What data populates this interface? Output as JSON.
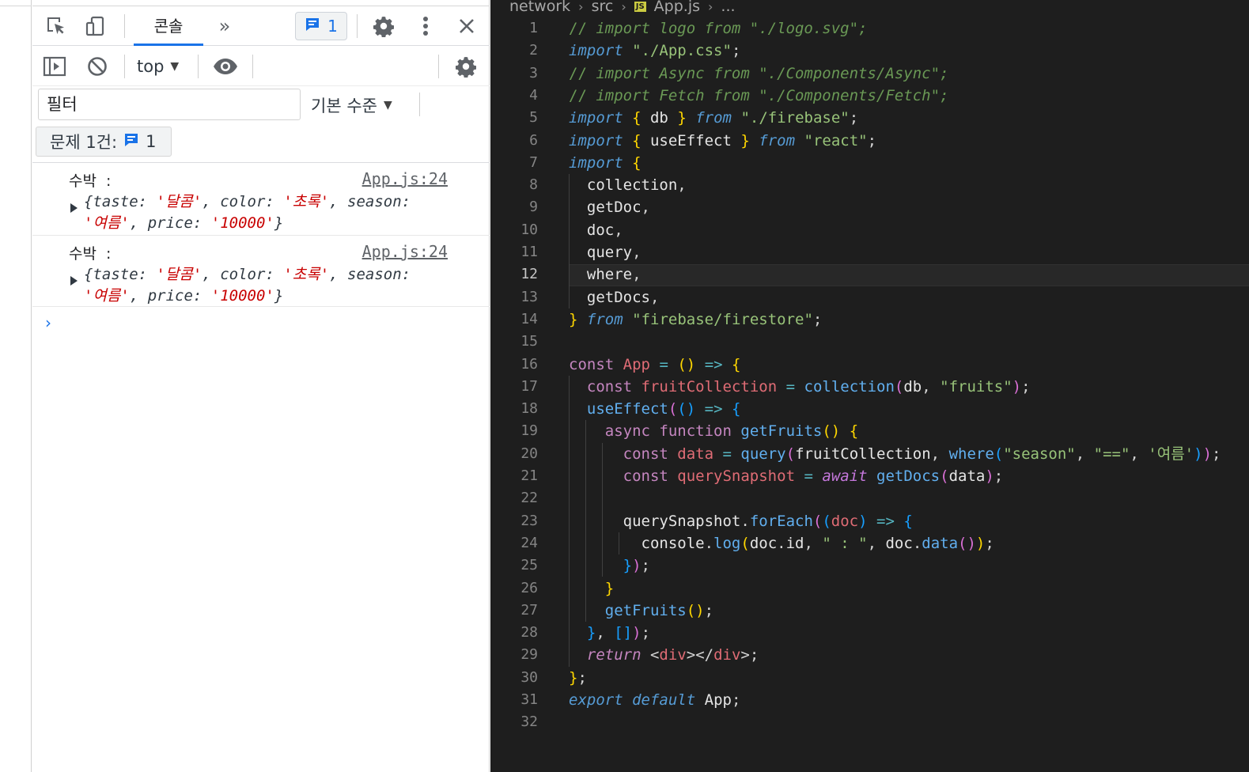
{
  "devtools": {
    "tabs": {
      "console_label": "콘솔",
      "more_label": "»",
      "issues_badge_count": "1"
    },
    "console_toolbar": {
      "context": "top",
      "level": "기본 수준",
      "filter_placeholder": "필터"
    },
    "issues_counter": {
      "label": "문제 1건:",
      "count": "1"
    },
    "messages": [
      {
        "label": "수박  :",
        "source": "App.js:24",
        "line1_prefix": "{taste: ",
        "taste": "'달콤'",
        "line1_mid": ", color: ",
        "color": "'초록'",
        "line1_suffix": ", season:",
        "season": "'여름'",
        "line2_mid": ", price: ",
        "price": "'10000'",
        "line2_suffix": "}"
      },
      {
        "label": "수박  :",
        "source": "App.js:24",
        "line1_prefix": "{taste: ",
        "taste": "'달콤'",
        "line1_mid": ", color: ",
        "color": "'초록'",
        "line1_suffix": ", season:",
        "season": "'여름'",
        "line2_mid": ", price: ",
        "price": "'10000'",
        "line2_suffix": "}"
      }
    ],
    "prompt": "›"
  },
  "editor": {
    "breadcrumb": [
      "network",
      "src",
      "App.js",
      "..."
    ],
    "file_badge": "JS",
    "active_line": 12,
    "line_numbers": [
      "1",
      "2",
      "3",
      "4",
      "5",
      "6",
      "7",
      "8",
      "9",
      "10",
      "11",
      "12",
      "13",
      "14",
      "15",
      "16",
      "17",
      "18",
      "19",
      "20",
      "21",
      "22",
      "23",
      "24",
      "25",
      "26",
      "27",
      "28",
      "29",
      "30",
      "31",
      "32"
    ],
    "code_tokens": [
      [
        [
          "cm-slash",
          "// "
        ],
        [
          "cm",
          "import logo from \"./logo.svg\";"
        ]
      ],
      [
        [
          "kw-i",
          "import"
        ],
        [
          "pl",
          " "
        ],
        [
          "s2",
          "\"./App.css\""
        ],
        [
          "pl",
          ";"
        ]
      ],
      [
        [
          "cm-slash",
          "// "
        ],
        [
          "cm",
          "import Async from \"./Components/Async\";"
        ]
      ],
      [
        [
          "cm-slash",
          "// "
        ],
        [
          "cm",
          "import Fetch from \"./Components/Fetch\";"
        ]
      ],
      [
        [
          "kw-i",
          "import"
        ],
        [
          "pl",
          " "
        ],
        [
          "b1",
          "{"
        ],
        [
          "id",
          " db "
        ],
        [
          "b1",
          "}"
        ],
        [
          "pl",
          " "
        ],
        [
          "kw-i",
          "from"
        ],
        [
          "pl",
          " "
        ],
        [
          "s2",
          "\"./firebase\""
        ],
        [
          "pl",
          ";"
        ]
      ],
      [
        [
          "kw-i",
          "import"
        ],
        [
          "pl",
          " "
        ],
        [
          "b1",
          "{"
        ],
        [
          "id",
          " useEffect "
        ],
        [
          "b1",
          "}"
        ],
        [
          "pl",
          " "
        ],
        [
          "kw-i",
          "from"
        ],
        [
          "pl",
          " "
        ],
        [
          "s2",
          "\"react\""
        ],
        [
          "pl",
          ";"
        ]
      ],
      [
        [
          "kw-i",
          "import"
        ],
        [
          "pl",
          " "
        ],
        [
          "b1",
          "{"
        ]
      ],
      [
        [
          "id",
          "  collection"
        ],
        [
          "pl",
          ","
        ]
      ],
      [
        [
          "id",
          "  getDoc"
        ],
        [
          "pl",
          ","
        ]
      ],
      [
        [
          "id",
          "  doc"
        ],
        [
          "pl",
          ","
        ]
      ],
      [
        [
          "id",
          "  query"
        ],
        [
          "pl",
          ","
        ]
      ],
      [
        [
          "id",
          "  where"
        ],
        [
          "pl",
          ","
        ]
      ],
      [
        [
          "id",
          "  getDocs"
        ],
        [
          "pl",
          ","
        ]
      ],
      [
        [
          "b1",
          "}"
        ],
        [
          "pl",
          " "
        ],
        [
          "kw-i",
          "from"
        ],
        [
          "pl",
          " "
        ],
        [
          "s2",
          "\"firebase/firestore\""
        ],
        [
          "pl",
          ";"
        ]
      ],
      [],
      [
        [
          "kw",
          "const"
        ],
        [
          "pl",
          " "
        ],
        [
          "v",
          "App"
        ],
        [
          "pl",
          " "
        ],
        [
          "op",
          "="
        ],
        [
          "pl",
          " "
        ],
        [
          "b1",
          "()"
        ],
        [
          "pl",
          " "
        ],
        [
          "op",
          "=>"
        ],
        [
          "pl",
          " "
        ],
        [
          "b1",
          "{"
        ]
      ],
      [
        [
          "pl",
          "  "
        ],
        [
          "kw",
          "const"
        ],
        [
          "pl",
          " "
        ],
        [
          "v",
          "fruitCollection"
        ],
        [
          "pl",
          " "
        ],
        [
          "op",
          "="
        ],
        [
          "pl",
          " "
        ],
        [
          "fn",
          "collection"
        ],
        [
          "b2",
          "("
        ],
        [
          "id",
          "db"
        ],
        [
          "pl",
          ", "
        ],
        [
          "s2",
          "\"fruits\""
        ],
        [
          "b2",
          ")"
        ],
        [
          "pl",
          ";"
        ]
      ],
      [
        [
          "pl",
          "  "
        ],
        [
          "fn",
          "useEffect"
        ],
        [
          "b2",
          "("
        ],
        [
          "b3",
          "()"
        ],
        [
          "pl",
          " "
        ],
        [
          "op",
          "=>"
        ],
        [
          "pl",
          " "
        ],
        [
          "b3",
          "{"
        ]
      ],
      [
        [
          "pl",
          "    "
        ],
        [
          "kw",
          "async"
        ],
        [
          "pl",
          " "
        ],
        [
          "kw",
          "function"
        ],
        [
          "pl",
          " "
        ],
        [
          "fn",
          "getFruits"
        ],
        [
          "b1",
          "()"
        ],
        [
          "pl",
          " "
        ],
        [
          "b1",
          "{"
        ]
      ],
      [
        [
          "pl",
          "      "
        ],
        [
          "kw",
          "const"
        ],
        [
          "pl",
          " "
        ],
        [
          "v",
          "data"
        ],
        [
          "pl",
          " "
        ],
        [
          "op",
          "="
        ],
        [
          "pl",
          " "
        ],
        [
          "fn",
          "query"
        ],
        [
          "b2",
          "("
        ],
        [
          "id",
          "fruitCollection"
        ],
        [
          "pl",
          ", "
        ],
        [
          "fn",
          "where"
        ],
        [
          "b3",
          "("
        ],
        [
          "s2",
          "\"season\""
        ],
        [
          "pl",
          ", "
        ],
        [
          "s2",
          "\"==\""
        ],
        [
          "pl",
          ", "
        ],
        [
          "s2",
          "'여름'"
        ],
        [
          "b3",
          ")"
        ],
        [
          "b2",
          ")"
        ],
        [
          "pl",
          ";"
        ]
      ],
      [
        [
          "pl",
          "      "
        ],
        [
          "kw",
          "const"
        ],
        [
          "pl",
          " "
        ],
        [
          "v",
          "querySnapshot"
        ],
        [
          "pl",
          " "
        ],
        [
          "op",
          "="
        ],
        [
          "pl",
          " "
        ],
        [
          "aw",
          "await"
        ],
        [
          "pl",
          " "
        ],
        [
          "fn",
          "getDocs"
        ],
        [
          "b2",
          "("
        ],
        [
          "id",
          "data"
        ],
        [
          "b2",
          ")"
        ],
        [
          "pl",
          ";"
        ]
      ],
      [],
      [
        [
          "pl",
          "      "
        ],
        [
          "id",
          "querySnapshot"
        ],
        [
          "pl",
          "."
        ],
        [
          "fn",
          "forEach"
        ],
        [
          "b2",
          "("
        ],
        [
          "b3",
          "("
        ],
        [
          "v",
          "doc"
        ],
        [
          "b3",
          ")"
        ],
        [
          "pl",
          " "
        ],
        [
          "op",
          "=>"
        ],
        [
          "pl",
          " "
        ],
        [
          "b3",
          "{"
        ]
      ],
      [
        [
          "pl",
          "        "
        ],
        [
          "id",
          "console"
        ],
        [
          "pl",
          "."
        ],
        [
          "fn",
          "log"
        ],
        [
          "b1",
          "("
        ],
        [
          "id",
          "doc"
        ],
        [
          "pl",
          "."
        ],
        [
          "id",
          "id"
        ],
        [
          "pl",
          ", "
        ],
        [
          "s2",
          "\" : \""
        ],
        [
          "pl",
          ", "
        ],
        [
          "id",
          "doc"
        ],
        [
          "pl",
          "."
        ],
        [
          "fn",
          "data"
        ],
        [
          "b2",
          "()"
        ],
        [
          "b1",
          ")"
        ],
        [
          "pl",
          ";"
        ]
      ],
      [
        [
          "pl",
          "      "
        ],
        [
          "b3",
          "}"
        ],
        [
          "b2",
          ")"
        ],
        [
          "pl",
          ";"
        ]
      ],
      [
        [
          "pl",
          "    "
        ],
        [
          "b1",
          "}"
        ]
      ],
      [
        [
          "pl",
          "    "
        ],
        [
          "fn",
          "getFruits"
        ],
        [
          "b1",
          "()"
        ],
        [
          "pl",
          ";"
        ]
      ],
      [
        [
          "pl",
          "  "
        ],
        [
          "b3",
          "}"
        ],
        [
          "pl",
          ", "
        ],
        [
          "b3",
          "[]"
        ],
        [
          "b2",
          ")"
        ],
        [
          "pl",
          ";"
        ]
      ],
      [
        [
          "pl",
          "  "
        ],
        [
          "kw-return",
          "return"
        ],
        [
          "pl",
          " <"
        ],
        [
          "tag",
          "div"
        ],
        [
          "pl",
          "></"
        ],
        [
          "tag",
          "div"
        ],
        [
          "pl",
          ">;"
        ]
      ],
      [
        [
          "b1",
          "}"
        ],
        [
          "pl",
          ";"
        ]
      ],
      [
        [
          "kw-i",
          "export"
        ],
        [
          "pl",
          " "
        ],
        [
          "kw-i",
          "default"
        ],
        [
          "pl",
          " "
        ],
        [
          "id",
          "App"
        ],
        [
          "pl",
          ";"
        ]
      ],
      []
    ]
  }
}
